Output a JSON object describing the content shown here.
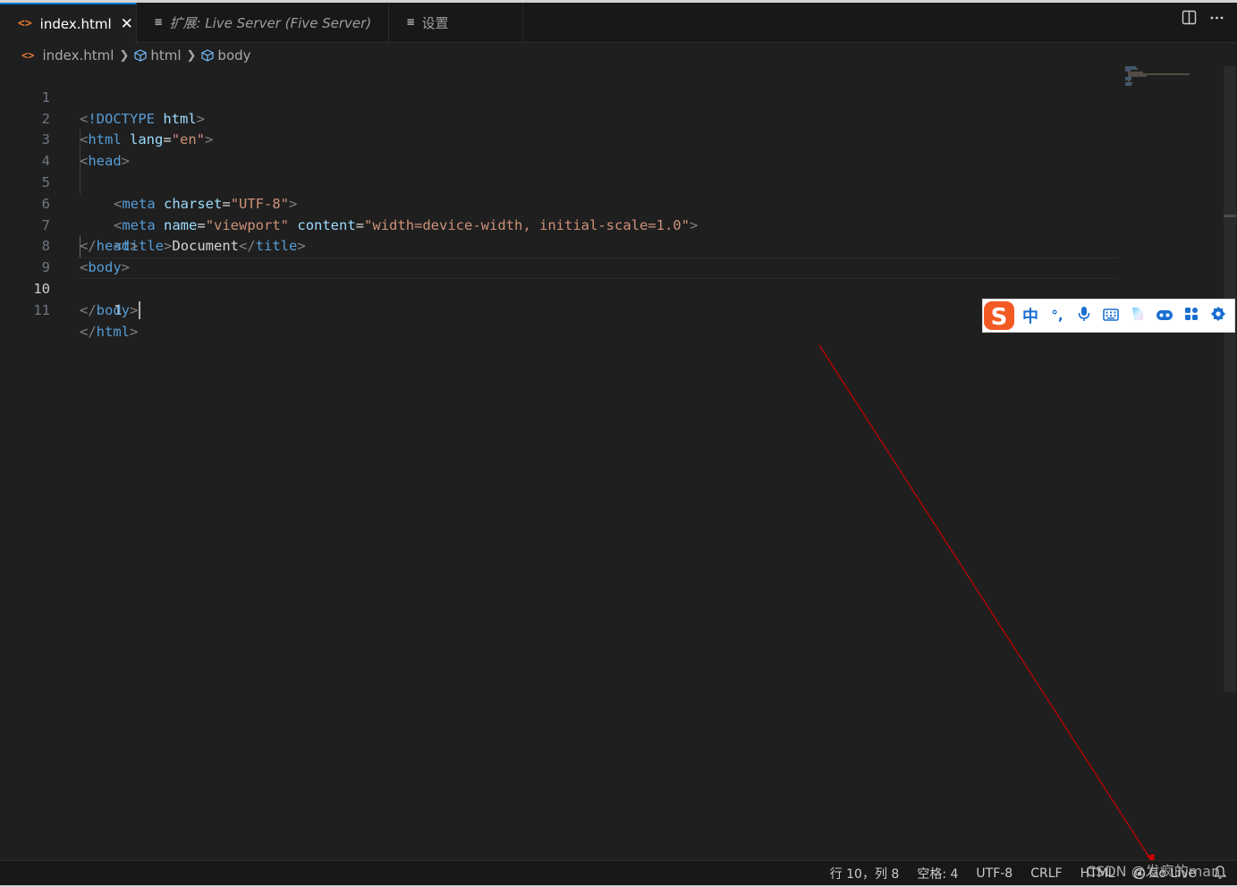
{
  "tabs": [
    {
      "label": "index.html",
      "icon": "html-file-icon",
      "active": true,
      "close_glyph": "✕"
    },
    {
      "label": "扩展: Live Server (Five Server)",
      "icon": "preview-doc-icon",
      "active": false,
      "italic": true
    },
    {
      "label": "设置",
      "icon": "settings-doc-icon",
      "active": false
    }
  ],
  "toolbar": {
    "split_icon": "split-editor-icon",
    "more_icon": "more-actions-icon"
  },
  "breadcrumb": {
    "file": "index.html",
    "items": [
      "html",
      "body"
    ]
  },
  "editor": {
    "current_line": 10,
    "line_numbers": [
      "1",
      "2",
      "3",
      "4",
      "5",
      "6",
      "7",
      "8",
      "9",
      "10",
      "11"
    ],
    "tokens": {
      "l1": {
        "open": "<",
        "doctype": "!DOCTYPE",
        "space": " ",
        "name": "html",
        "close": ">"
      },
      "l2": {
        "open": "<",
        "tag": "html",
        "attr": "lang",
        "eq": "=",
        "val": "\"en\"",
        "close": ">"
      },
      "l3": {
        "open": "<",
        "tag": "head",
        "close": ">"
      },
      "l4": {
        "open": "<",
        "tag": "meta",
        "attr": "charset",
        "eq": "=",
        "val": "\"UTF-8\"",
        "close": ">"
      },
      "l5": {
        "open": "<",
        "tag": "meta",
        "attr1": "name",
        "eq1": "=",
        "val1": "\"viewport\"",
        "attr2": "content",
        "eq2": "=",
        "val2": "\"width=device-width, initial-scale=1.0\"",
        "close": ">"
      },
      "l6": {
        "open": "<",
        "tag": "title",
        "close": ">",
        "text": "Document",
        "open2": "</",
        "tag2": "title",
        "close2": ">"
      },
      "l7": {
        "open": "</",
        "tag": "head",
        "close": ">"
      },
      "l8": {
        "open": "<",
        "tag": "body",
        "close": ">"
      },
      "l9": {
        "text": "1"
      },
      "l10": {
        "open": "</",
        "tag": "body",
        "close": ">"
      },
      "l11": {
        "open": "</",
        "tag": "html",
        "close": ">"
      }
    }
  },
  "ime": {
    "logo": "sogou-logo",
    "items": [
      {
        "label": "中",
        "name": "ime-chinese-mode"
      },
      {
        "label": "°,",
        "name": "ime-punctuation"
      },
      {
        "label": "🎤",
        "name": "ime-voice-icon"
      },
      {
        "label": "⌨",
        "name": "ime-keyboard-icon"
      },
      {
        "label": "",
        "name": "ime-skin-icon"
      },
      {
        "label": "",
        "name": "ime-game-icon"
      },
      {
        "label": "",
        "name": "ime-apps-icon"
      },
      {
        "label": "",
        "name": "ime-settings-icon"
      }
    ]
  },
  "statusbar": {
    "position": "行 10，列 8",
    "spaces": "空格: 4",
    "encoding": "UTF-8",
    "eol": "CRLF",
    "language": "HTML",
    "golive": "Go Live",
    "notification_icon": "bell-icon"
  },
  "watermark": "CSDN @发疯的man",
  "colors": {
    "accent": "#0078d4",
    "arrow": "#cc0000",
    "ime_blue": "#1a6fd1",
    "sogou_orange": "#f25a24"
  }
}
